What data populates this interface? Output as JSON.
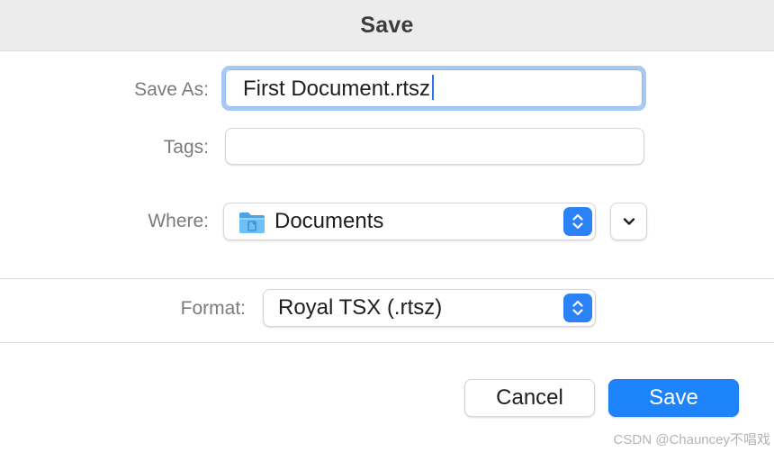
{
  "dialog": {
    "title": "Save"
  },
  "save_as": {
    "label": "Save As:",
    "value": "First Document.rtsz"
  },
  "tags": {
    "label": "Tags:",
    "value": ""
  },
  "where": {
    "label": "Where:",
    "selected": "Documents",
    "icon": "folder-icon"
  },
  "format": {
    "label": "Format:",
    "selected": "Royal TSX (.rtsz)"
  },
  "buttons": {
    "cancel": "Cancel",
    "save": "Save"
  },
  "watermark": "CSDN @Chauncey不唱戏",
  "colors": {
    "accent": "#1c83fb",
    "focus_ring": "#a8c8f4",
    "titlebar": "#ececec"
  }
}
